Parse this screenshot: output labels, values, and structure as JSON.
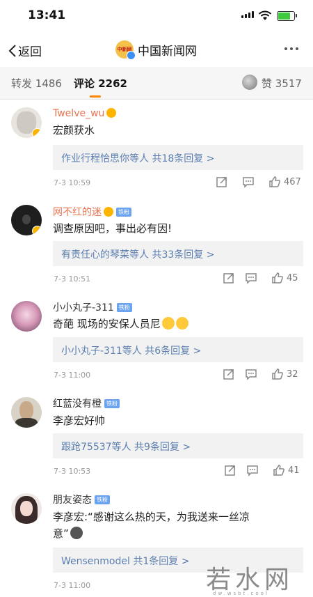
{
  "status_bar": {
    "time": "13:41"
  },
  "nav": {
    "back_label": "返回",
    "title": "中国新闻网",
    "logo_text": "中新网"
  },
  "tabs": {
    "repost": "转发 1486",
    "comments": "评论 2262",
    "likes": "赞 3517"
  },
  "comments": [
    {
      "user": "Twelve_wu",
      "text": "宏颜获水",
      "reply": "作业行程恰思你等人  共18条回复 >",
      "time": "7-3 10:59",
      "likes": "467"
    },
    {
      "user": "网不红的迷",
      "badge": "铁粉",
      "text": "调查原因吧，事出必有因!",
      "reply": "有责任心的琴菜等人  共33条回复 >",
      "time": "7-3 10:51",
      "likes": "45"
    },
    {
      "user": "小小丸子-311",
      "badge": "铁粉",
      "text": "奇葩   现场的安保人员尼",
      "reply": "小小丸子-311等人  共6条回复 >",
      "time": "7-3 11:00",
      "likes": "32"
    },
    {
      "user": "红蓝没有橙",
      "badge": "铁粉",
      "text": "李彦宏好帅",
      "reply": "跟跄75537等人  共9条回复 >",
      "time": "7-3 10:53",
      "likes": "41"
    },
    {
      "user": "朋友姿态",
      "badge": "铁粉",
      "text_line1": "李彦宏:“感谢这么热的天，为我送来一丝凉",
      "text_line2": "意”",
      "reply": "Wensenmodel  共1条回复 >",
      "time": "7-3 11:00"
    }
  ],
  "watermark": {
    "main": "若水网",
    "sub": "dw.wsbt.cool"
  },
  "colors": {
    "orange_name": "#eb7350",
    "link_blue": "#5a7eb0",
    "tab_accent": "#ff8200"
  }
}
